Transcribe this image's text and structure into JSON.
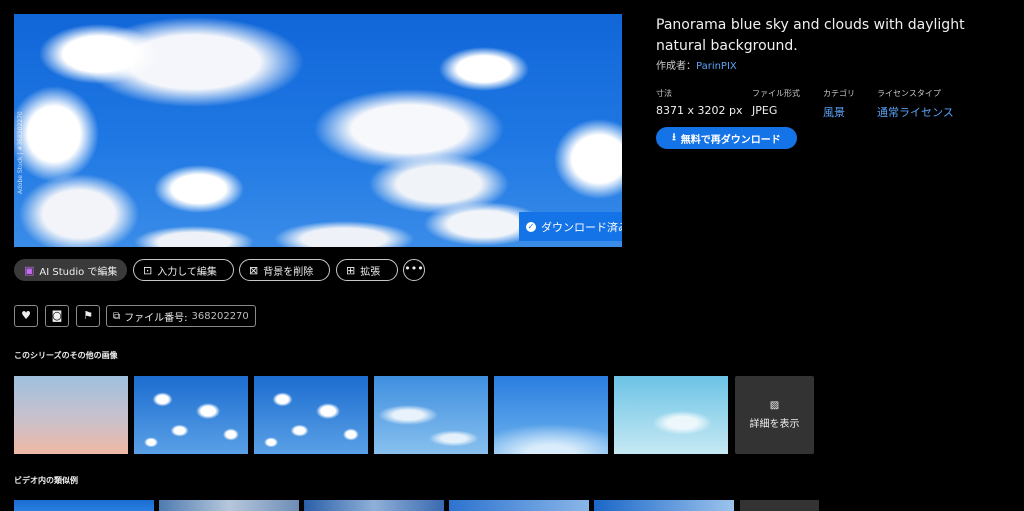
{
  "preview": {
    "credit": "Adobe Stock | #368202270",
    "downloaded_badge": "ダウンロード済み"
  },
  "asset": {
    "title": "Panorama blue sky and clouds with daylight natural background.",
    "creator_label": "作成者：",
    "creator_name": "ParinPIX",
    "meta": [
      {
        "label": "寸法",
        "value": "8371 x 3202 px",
        "link": false
      },
      {
        "label": "ファイル形式",
        "value": "JPEG",
        "link": false
      },
      {
        "label": "カテゴリ",
        "value": "風景",
        "link": true
      },
      {
        "label": "ライセンスタイプ",
        "value": "通常ライセンス",
        "link": true
      }
    ],
    "redownload_label": "無料で再ダウンロード"
  },
  "actions": {
    "ai_studio": "AI Studio で編集",
    "input_edit": "入力して編集",
    "remove_bg": "背景を削除",
    "expand": "拡張",
    "more": "•••"
  },
  "tools": {
    "file_number_label": "ファイル番号:",
    "file_number": "368202270"
  },
  "series": {
    "heading": "このシリーズのその他の画像",
    "show_details": "詳細を表示"
  },
  "video": {
    "heading": "ビデオ内の類似例"
  },
  "colors": {
    "accent": "#1473e6",
    "link": "#5aa2f5",
    "background": "#000000"
  }
}
